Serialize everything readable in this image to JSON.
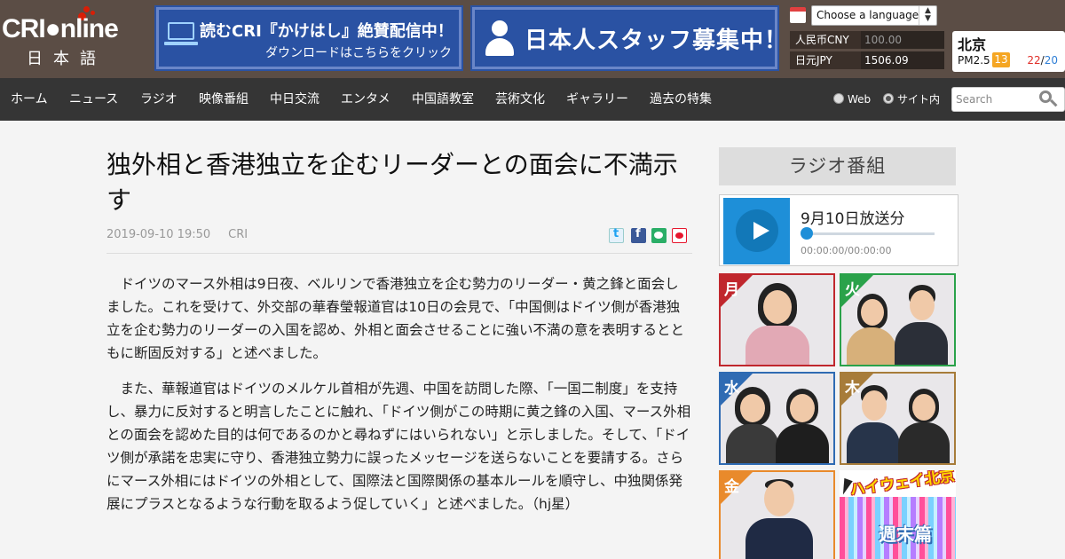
{
  "brand": {
    "logo_text": "CRI●nline",
    "logo_sub": "日本語"
  },
  "banners": {
    "kakehashi": {
      "title": "読むCRI『かけはし』絶賛配信中！",
      "subtitle": "ダウンロードはこちらをクリック"
    },
    "staff": {
      "title": "日本人スタッフ募集中！"
    }
  },
  "language_select": {
    "selected": "Choose a language"
  },
  "exchange": [
    {
      "label": "人民币CNY",
      "value": "100.00"
    },
    {
      "label": "日元JPY",
      "value": "1506.09"
    }
  ],
  "weather": {
    "city": "北京",
    "pm_label": "PM2.5",
    "aqi": "13",
    "high": "22",
    "separator": "/",
    "low": "20"
  },
  "nav": {
    "items": [
      "ホーム",
      "ニュース",
      "ラジオ",
      "映像番組",
      "中日交流",
      "エンタメ",
      "中国語教室",
      "芸術文化",
      "ギャラリー",
      "過去の特集"
    ],
    "radio_web": "Web",
    "radio_site": "サイト内",
    "search_placeholder": "Search"
  },
  "article": {
    "headline": "独外相と香港独立を企むリーダーとの面会に不満示す",
    "date": "2019-09-10 19:50",
    "source": "CRI",
    "paragraphs": [
      "ドイツのマース外相は9日夜、ベルリンで香港独立を企む勢力のリーダー・黄之鋒と面会しました。これを受けて、外交部の華春瑩報道官は10日の会見で、「中国側はドイツ側が香港独立を企む勢力のリーダーの入国を認め、外相と面会させることに強い不満の意を表明するとともに断固反対する」と述べました。",
      "また、華報道官はドイツのメルケル首相が先週、中国を訪問した際、「一国二制度」を支持し、暴力に反対すると明言したことに触れ、「ドイツ側がこの時期に黄之鋒の入国、マース外相との面会を認めた目的は何であるのかと尋ねずにはいられない」と示しました。そして、「ドイツ側が承諾を忠実に守り、香港独立勢力に誤ったメッセージを送らないことを要請する。さらにマース外相にはドイツの外相として、国際法と国際関係の基本ルールを順守し、中独関係発展にプラスとなるような行動を取るよう促していく」と述べました。（hj星）"
    ]
  },
  "sidebar": {
    "title": "ラジオ番組",
    "player": {
      "date": "9月10日放送分",
      "time": "00:00:00/00:00:00",
      "progress": 0
    },
    "days": [
      {
        "tag": "月",
        "color": "#c0272d"
      },
      {
        "tag": "火",
        "color": "#2aa24a"
      },
      {
        "tag": "水",
        "color": "#2f6bb3"
      },
      {
        "tag": "木",
        "color": "#a77c3a"
      },
      {
        "tag": "金",
        "color": "#e98a2b"
      }
    ],
    "highway": {
      "title": "ハイウェイ北京",
      "subtitle": "週末篇"
    }
  }
}
